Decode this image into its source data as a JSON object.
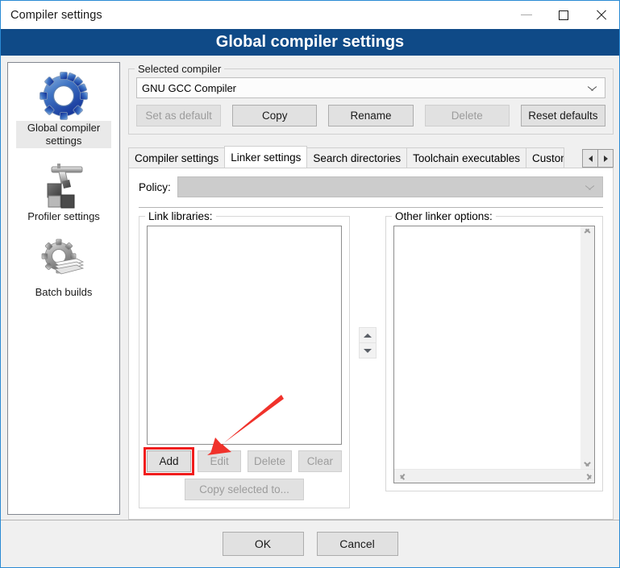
{
  "window": {
    "title": "Compiler settings",
    "banner": "Global compiler settings",
    "caption": {
      "minimize": "minimize",
      "maximize": "maximize",
      "close": "close"
    }
  },
  "colors": {
    "banner_blue": "#0f4a87",
    "window_border_blue": "#2a8ad4",
    "dialog_background": "#f0f0f0",
    "annotation_red": "#f01c1c",
    "button_face": "#e1e1e1",
    "disabled_text": "#9c9c9c"
  },
  "sidebar": {
    "items": [
      {
        "label": "Global compiler settings",
        "icon": "blue-gear-icon",
        "selected": true
      },
      {
        "label": "Profiler settings",
        "icon": "robot-arm-icon",
        "selected": false
      },
      {
        "label": "Batch builds",
        "icon": "gear-stack-icon",
        "selected": false
      }
    ]
  },
  "selected_compiler": {
    "group_title": "Selected compiler",
    "combo_value": "GNU GCC Compiler",
    "buttons": [
      {
        "label": "Set as default",
        "enabled": false
      },
      {
        "label": "Copy",
        "enabled": true
      },
      {
        "label": "Rename",
        "enabled": true
      },
      {
        "label": "Delete",
        "enabled": false
      },
      {
        "label": "Reset defaults",
        "enabled": true
      }
    ]
  },
  "tabs": {
    "items": [
      {
        "label": "Compiler settings",
        "active": false,
        "clipped": false
      },
      {
        "label": "Linker settings",
        "active": true,
        "clipped": false
      },
      {
        "label": "Search directories",
        "active": false,
        "clipped": false
      },
      {
        "label": "Toolchain executables",
        "active": false,
        "clipped": false
      },
      {
        "label": "Custom",
        "active": false,
        "clipped": true
      }
    ],
    "scroll_left_icon": "triangle-left-icon",
    "scroll_right_icon": "triangle-right-icon"
  },
  "linker_page": {
    "policy_label": "Policy:",
    "policy_value": "",
    "link_libraries": {
      "group_title": "Link libraries:",
      "items": [],
      "buttons": [
        {
          "label": "Add",
          "enabled": true,
          "highlighted": true
        },
        {
          "label": "Edit",
          "enabled": false,
          "highlighted": false
        },
        {
          "label": "Delete",
          "enabled": false,
          "highlighted": false
        },
        {
          "label": "Clear",
          "enabled": false,
          "highlighted": false
        }
      ],
      "copy_selected_button": {
        "label": "Copy selected to...",
        "enabled": false
      }
    },
    "reorder": {
      "up_icon": "triangle-up-icon",
      "down_icon": "triangle-down-icon"
    },
    "other_linker_options": {
      "group_title": "Other linker options:",
      "value": "",
      "vscroll_up_icon": "chevron-up-icon",
      "vscroll_down_icon": "chevron-down-icon",
      "hscroll_left_icon": "chevron-left-icon",
      "hscroll_right_icon": "chevron-right-icon"
    }
  },
  "footer": {
    "ok_label": "OK",
    "cancel_label": "Cancel"
  },
  "annotation": {
    "arrow": "red-arrow-pointing-to-add-button",
    "highlight": "red-rectangle-around-add-button"
  }
}
